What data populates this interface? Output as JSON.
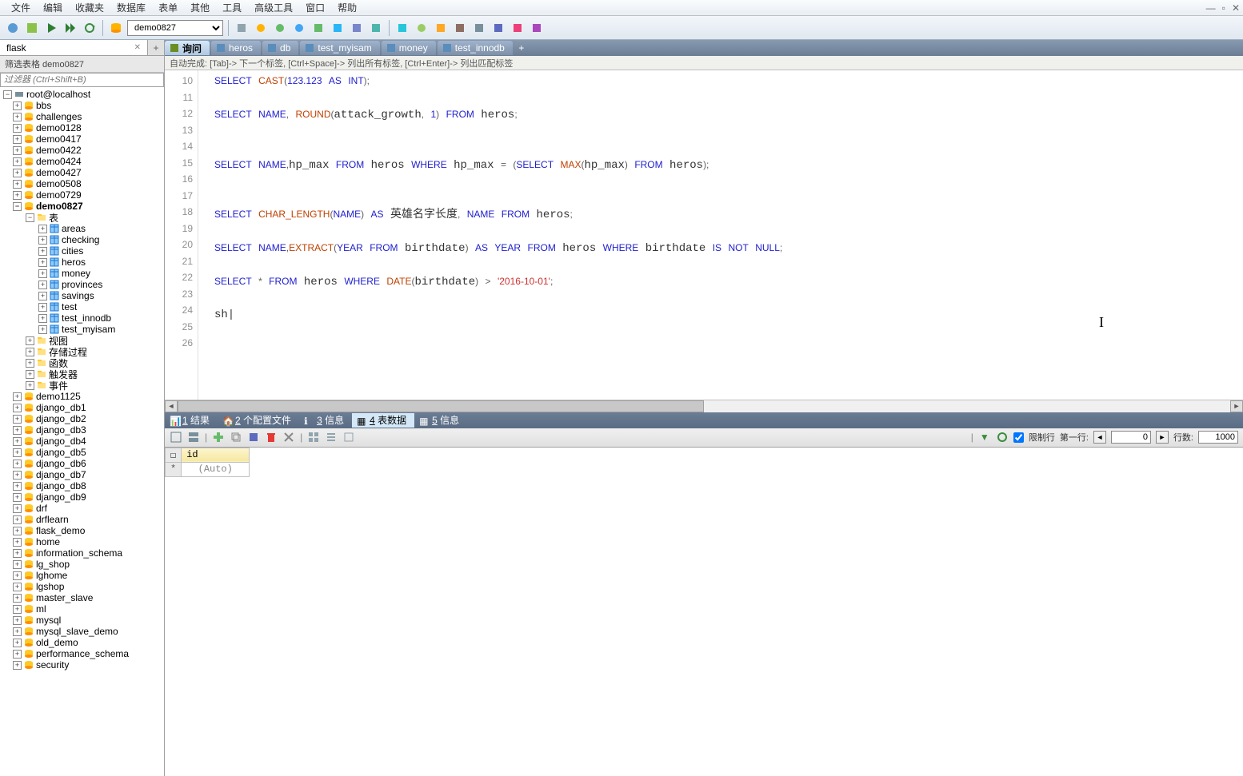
{
  "menu": {
    "file": "文件",
    "edit": "编辑",
    "favorites": "收藏夹",
    "database": "数据库",
    "table": "表单",
    "other": "其他",
    "tools": "工具",
    "advanced": "高级工具",
    "window": "窗口",
    "help": "帮助"
  },
  "toolbar": {
    "db_selected": "demo0827"
  },
  "sidebar": {
    "tab_label": "flask",
    "title": "筛选表格 demo0827",
    "filter_placeholder": "过滤器 (Ctrl+Shift+B)",
    "root": "root@localhost",
    "databases": [
      "bbs",
      "challenges",
      "demo0128",
      "demo0417",
      "demo0422",
      "demo0424",
      "demo0427",
      "demo0508",
      "demo0729"
    ],
    "current_db": "demo0827",
    "tables_label": "表",
    "tables": [
      "areas",
      "checking",
      "cities",
      "heros",
      "money",
      "provinces",
      "savings",
      "test",
      "test_innodb",
      "test_myisam"
    ],
    "db_folders": [
      "视图",
      "存储过程",
      "函数",
      "触发器",
      "事件"
    ],
    "databases_after": [
      "demo1125",
      "django_db1",
      "django_db2",
      "django_db3",
      "django_db4",
      "django_db5",
      "django_db6",
      "django_db7",
      "django_db8",
      "django_db9",
      "drf",
      "drflearn",
      "flask_demo",
      "home",
      "information_schema",
      "lg_shop",
      "lghome",
      "lgshop",
      "master_slave",
      "ml",
      "mysql",
      "mysql_slave_demo",
      "old_demo",
      "performance_schema",
      "security"
    ]
  },
  "editor_tabs": [
    {
      "label": "询问",
      "active": true,
      "icon": "query"
    },
    {
      "label": "heros",
      "icon": "table"
    },
    {
      "label": "db",
      "icon": "table"
    },
    {
      "label": "test_myisam",
      "icon": "table"
    },
    {
      "label": "money",
      "icon": "table"
    },
    {
      "label": "test_innodb",
      "icon": "table"
    }
  ],
  "autocomplete_hint": "自动完成:  [Tab]-> 下一个标签,  [Ctrl+Space]-> 列出所有标签,  [Ctrl+Enter]-> 列出匹配标签",
  "code_lines": {
    "start": 10,
    "end": 26,
    "current_input": "sh"
  },
  "result_tabs": [
    {
      "label": "1 结果",
      "icon": "📊"
    },
    {
      "label": "2 个配置文件",
      "icon": "🏠"
    },
    {
      "label": "3 信息",
      "icon": "ℹ"
    },
    {
      "label": "4 表数据",
      "icon": "▦",
      "active": true
    },
    {
      "label": "5 信息",
      "icon": "▦"
    }
  ],
  "result_toolbar": {
    "limit_rows_label": "限制行",
    "first_row_label": "第一行:",
    "first_row_value": "0",
    "row_count_label": "行数:",
    "row_count_value": "1000"
  },
  "result_grid": {
    "column": "id",
    "auto_value": "(Auto)",
    "new_row": "*",
    "checkbox": "☐"
  }
}
